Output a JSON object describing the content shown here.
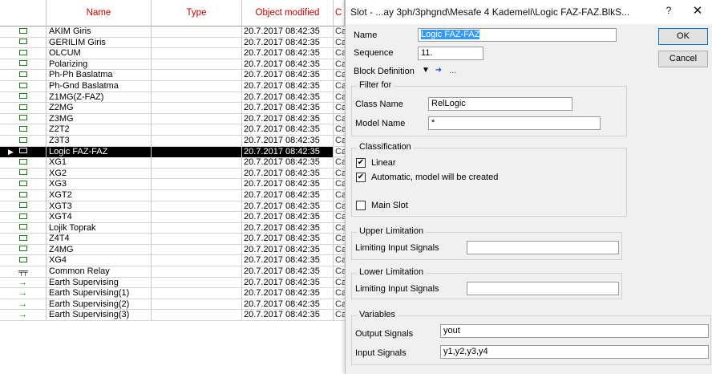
{
  "table": {
    "headers": {
      "name": "Name",
      "type": "Type",
      "modified": "Object modified",
      "extra": "C"
    },
    "rows": [
      {
        "icon": "slot-icon",
        "name": "AKIM Giris",
        "type": "",
        "modified": "20.7.2017 08:42:35",
        "extra": "Ca"
      },
      {
        "icon": "slot-icon",
        "name": "GERILIM Giris",
        "type": "",
        "modified": "20.7.2017 08:42:35",
        "extra": "Ca"
      },
      {
        "icon": "slot-icon",
        "name": "OLCUM",
        "type": "",
        "modified": "20.7.2017 08:42:35",
        "extra": "Ca"
      },
      {
        "icon": "slot-icon",
        "name": "Polarizing",
        "type": "",
        "modified": "20.7.2017 08:42:35",
        "extra": "Ca"
      },
      {
        "icon": "slot-icon",
        "name": "Ph-Ph Baslatma",
        "type": "",
        "modified": "20.7.2017 08:42:35",
        "extra": "Ca"
      },
      {
        "icon": "slot-icon",
        "name": "Ph-Gnd Baslatma",
        "type": "",
        "modified": "20.7.2017 08:42:35",
        "extra": "Ca"
      },
      {
        "icon": "slot-icon",
        "name": "Z1MG(Z-FAZ)",
        "type": "",
        "modified": "20.7.2017 08:42:35",
        "extra": "Ca"
      },
      {
        "icon": "slot-icon",
        "name": "Z2MG",
        "type": "",
        "modified": "20.7.2017 08:42:35",
        "extra": "Ca"
      },
      {
        "icon": "slot-icon",
        "name": "Z3MG",
        "type": "",
        "modified": "20.7.2017 08:42:35",
        "extra": "Ca"
      },
      {
        "icon": "slot-icon",
        "name": "Z2T2",
        "type": "",
        "modified": "20.7.2017 08:42:35",
        "extra": "Ca"
      },
      {
        "icon": "slot-icon",
        "name": "Z3T3",
        "type": "",
        "modified": "20.7.2017 08:42:35",
        "extra": "Ca"
      },
      {
        "icon": "slot-icon",
        "name": "Logic FAZ-FAZ",
        "type": "",
        "modified": "20.7.2017 08:42:35",
        "extra": "Ca",
        "selected": true
      },
      {
        "icon": "slot-icon",
        "name": "XG1",
        "type": "",
        "modified": "20.7.2017 08:42:35",
        "extra": "Ca"
      },
      {
        "icon": "slot-icon",
        "name": "XG2",
        "type": "",
        "modified": "20.7.2017 08:42:35",
        "extra": "Ca"
      },
      {
        "icon": "slot-icon",
        "name": "XG3",
        "type": "",
        "modified": "20.7.2017 08:42:35",
        "extra": "Ca"
      },
      {
        "icon": "slot-icon",
        "name": "XGT2",
        "type": "",
        "modified": "20.7.2017 08:42:35",
        "extra": "Ca"
      },
      {
        "icon": "slot-icon",
        "name": "XGT3",
        "type": "",
        "modified": "20.7.2017 08:42:35",
        "extra": "Ca"
      },
      {
        "icon": "slot-icon",
        "name": "XGT4",
        "type": "",
        "modified": "20.7.2017 08:42:35",
        "extra": "Ca"
      },
      {
        "icon": "slot-icon",
        "name": "Lojik Toprak",
        "type": "",
        "modified": "20.7.2017 08:42:35",
        "extra": "Ca"
      },
      {
        "icon": "slot-icon",
        "name": "Z4T4",
        "type": "",
        "modified": "20.7.2017 08:42:35",
        "extra": "Ca"
      },
      {
        "icon": "slot-icon",
        "name": "Z4MG",
        "type": "",
        "modified": "20.7.2017 08:42:35",
        "extra": "Ca"
      },
      {
        "icon": "slot-icon",
        "name": "XG4",
        "type": "",
        "modified": "20.7.2017 08:42:35",
        "extra": "Ca"
      },
      {
        "icon": "relay-icon",
        "name": "Common Relay",
        "type": "",
        "modified": "20.7.2017 08:42:35",
        "extra": "Ca"
      },
      {
        "icon": "arrow-right-icon",
        "name": "Earth Supervising",
        "type": "",
        "modified": "20.7.2017 08:42:35",
        "extra": "Ca"
      },
      {
        "icon": "arrow-right-icon",
        "name": "Earth Supervising(1)",
        "type": "",
        "modified": "20.7.2017 08:42:35",
        "extra": "Ca"
      },
      {
        "icon": "arrow-right-icon",
        "name": "Earth Supervising(2)",
        "type": "",
        "modified": "20.7.2017 08:42:35",
        "extra": "Ca"
      },
      {
        "icon": "arrow-right-icon",
        "name": "Earth Supervising(3)",
        "type": "",
        "modified": "20.7.2017 08:42:35",
        "extra": "Ca"
      }
    ]
  },
  "dialog": {
    "title": "Slot - ...ay 3ph/3phgnd\\Mesafe 4 Kademeli\\Logic FAZ-FAZ.BlkS...",
    "help": "?",
    "close": "✕",
    "name_label": "Name",
    "name_value": "Logic FAZ-FAZ",
    "sequence_label": "Sequence",
    "sequence_value": "11.",
    "block_def_label": "Block Definition",
    "block_def_ellipsis": "...",
    "ok_label": "OK",
    "cancel_label": "Cancel",
    "filter": {
      "title": "Filter for",
      "class_label": "Class Name",
      "class_value": "RelLogic",
      "model_label": "Model Name",
      "model_value": "*"
    },
    "classification": {
      "title": "Classification",
      "linear_label": "Linear",
      "linear_checked": true,
      "auto_label": "Automatic, model will be created",
      "auto_checked": true,
      "main_label": "Main Slot",
      "main_checked": false
    },
    "upper": {
      "title": "Upper Limitation",
      "label": "Limiting Input Signals",
      "value": ""
    },
    "lower": {
      "title": "Lower Limitation",
      "label": "Limiting Input Signals",
      "value": ""
    },
    "variables": {
      "title": "Variables",
      "output_label": "Output Signals",
      "output_value": "yout",
      "input_label": "Input Signals",
      "input_value": "y1,y2,y3,y4"
    }
  },
  "colors": {
    "header_text": "#c00000",
    "selection": "#000000",
    "icon_green": "#1a7a1a",
    "highlight": "#3399ff"
  }
}
